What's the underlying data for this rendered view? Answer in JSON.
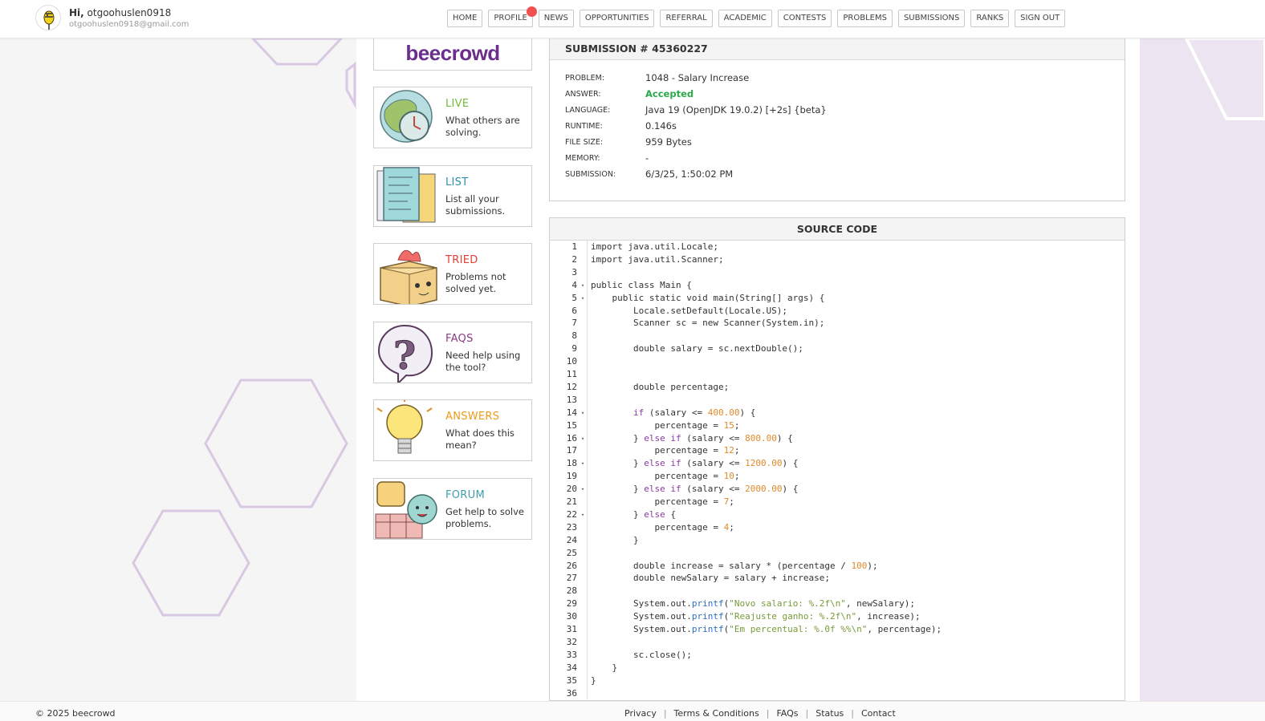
{
  "user": {
    "greeting": "Hi,",
    "name": "otgoohuslen0918",
    "email": "otgoohuslen0918@gmail.com"
  },
  "nav": [
    {
      "label": "HOME",
      "name": "nav-home"
    },
    {
      "label": "PROFILE",
      "name": "nav-profile",
      "notification": true
    },
    {
      "label": "NEWS",
      "name": "nav-news"
    },
    {
      "label": "OPPORTUNITIES",
      "name": "nav-opportunities"
    },
    {
      "label": "REFERRAL",
      "name": "nav-referral"
    },
    {
      "label": "ACADEMIC",
      "name": "nav-academic"
    },
    {
      "label": "CONTESTS",
      "name": "nav-contests"
    },
    {
      "label": "PROBLEMS",
      "name": "nav-problems"
    },
    {
      "label": "SUBMISSIONS",
      "name": "nav-submissions"
    },
    {
      "label": "RANKS",
      "name": "nav-ranks"
    },
    {
      "label": "SIGN OUT",
      "name": "nav-sign-out"
    }
  ],
  "logo": "beecrowd",
  "menu": [
    {
      "title": "LIVE",
      "desc": "What others are solving.",
      "color": "#74b93a",
      "icon": "globe-clock-icon"
    },
    {
      "title": "LIST",
      "desc": "List all your submissions.",
      "color": "#2e8fb0",
      "icon": "notes-list-icon"
    },
    {
      "title": "TRIED",
      "desc": "Problems not solved yet.",
      "color": "#e2403a",
      "icon": "box-icon"
    },
    {
      "title": "FAQS",
      "desc": "Need help using the tool?",
      "color": "#8a3a82",
      "icon": "question-bubble-icon"
    },
    {
      "title": "ANSWERS",
      "desc": "What does this mean?",
      "color": "#ef9a17",
      "icon": "lightbulb-icon"
    },
    {
      "title": "FORUM",
      "desc": "Get help to solve problems.",
      "color": "#3f9ea8",
      "icon": "chat-faces-icon"
    }
  ],
  "submission": {
    "title": "SUBMISSION # 45360227",
    "rows": [
      {
        "label": "PROBLEM:",
        "value": "1048 - Salary Increase"
      },
      {
        "label": "ANSWER:",
        "value": "Accepted",
        "status": true
      },
      {
        "label": "LANGUAGE:",
        "value": "Java 19 (OpenJDK 19.0.2) [+2s] {beta}"
      },
      {
        "label": "RUNTIME:",
        "value": "0.146s"
      },
      {
        "label": "FILE SIZE:",
        "value": "959 Bytes"
      },
      {
        "label": "MEMORY:",
        "value": "-"
      },
      {
        "label": "SUBMISSION:",
        "value": "6/3/25, 1:50:02 PM"
      }
    ]
  },
  "source": {
    "title": "SOURCE CODE",
    "fold_lines": [
      4,
      5,
      14,
      16,
      18,
      20,
      22
    ],
    "lines": [
      "import java.util.Locale;",
      "import java.util.Scanner;",
      "",
      "public class Main {",
      "    public static void main(String[] args) {",
      "        Locale.setDefault(Locale.US);",
      "        Scanner sc = new Scanner(System.in);",
      "",
      "        double salary = sc.nextDouble();",
      "",
      "",
      "        double percentage;",
      "",
      "        if (salary <= 400.00) {",
      "            percentage = 15;",
      "        } else if (salary <= 800.00) {",
      "            percentage = 12;",
      "        } else if (salary <= 1200.00) {",
      "            percentage = 10;",
      "        } else if (salary <= 2000.00) {",
      "            percentage = 7;",
      "        } else {",
      "            percentage = 4;",
      "        }",
      "",
      "        double increase = salary * (percentage / 100);",
      "        double newSalary = salary + increase;",
      "",
      "        System.out.printf(\"Novo salario: %.2f\\n\", newSalary);",
      "        System.out.printf(\"Reajuste ganho: %.2f\\n\", increase);",
      "        System.out.printf(\"Em percentual: %.0f %%\\n\", percentage);",
      "",
      "        sc.close();",
      "    }",
      "}",
      ""
    ]
  },
  "footer": {
    "copyright": "© 2025 beecrowd",
    "links": [
      {
        "label": "Privacy",
        "name": "footer-privacy-link"
      },
      {
        "label": "Terms & Conditions",
        "name": "footer-terms-link"
      },
      {
        "label": "FAQs",
        "name": "footer-faqs-link"
      },
      {
        "label": "Status",
        "name": "footer-status-link"
      },
      {
        "label": "Contact",
        "name": "footer-contact-link"
      }
    ]
  },
  "colors": {
    "accent": "#6a2e8c",
    "accepted": "#2aa84a",
    "notification": "#f05050",
    "hexagon": "#d8c8e2"
  }
}
